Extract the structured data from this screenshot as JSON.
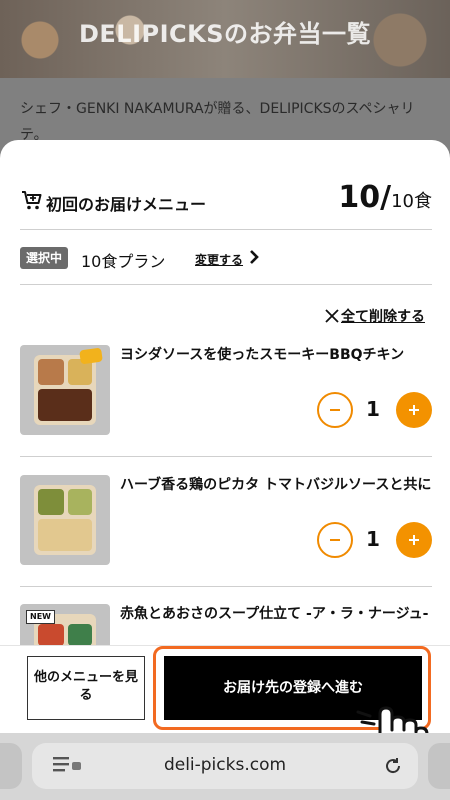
{
  "background": {
    "hero_title": "DELIPICKSのお弁当一覧",
    "intro_text": "シェフ・GENKI NAKAMURAが贈る、DELIPICKSのスペシャリテ。"
  },
  "sheet": {
    "title": "初回のお届けメニュー",
    "count_selected": "10",
    "count_slash": "/",
    "count_total": "10食",
    "plan_badge": "選択中",
    "plan_name": "10食プラン",
    "plan_change": "変更する",
    "clear_all": "全て削除する"
  },
  "items": [
    {
      "name": "ヨシダソースを使ったスモーキーBBQチキン",
      "quantity": "1"
    },
    {
      "name": "ハーブ香る鶏のピカタ トマトバジルソースと共に",
      "quantity": "1"
    },
    {
      "name": "赤魚とあおさのスープ仕立て -ア・ラ・ナージュ-",
      "quantity": "",
      "badge": "NEW"
    }
  ],
  "footer": {
    "other_menu": "他のメニューを見る",
    "next_button": "お届け先の登録へ進む"
  },
  "browser": {
    "url": "deli-picks.com"
  },
  "colors": {
    "accent_orange": "#f39200",
    "highlight_ring": "#f26a21",
    "primary_black": "#000000"
  },
  "icons": [
    "cart-icon",
    "chevron-right-icon",
    "close-icon",
    "minus-icon",
    "plus-icon",
    "pointer-hand-icon",
    "reader-mode-icon",
    "reload-icon"
  ]
}
